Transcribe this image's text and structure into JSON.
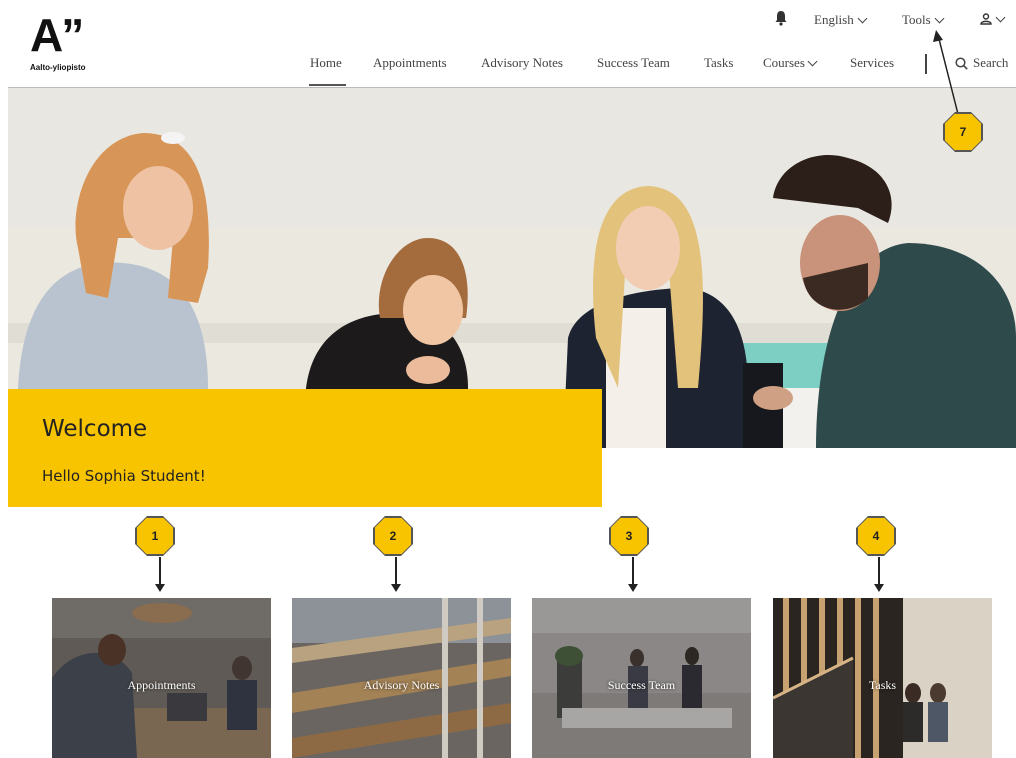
{
  "brand": {
    "mark": "A”",
    "name": "Aalto-yliopisto"
  },
  "utility": {
    "notifications_icon": "bell-icon",
    "language": "English",
    "tools": "Tools",
    "user_icon": "user-icon"
  },
  "nav": {
    "items": [
      {
        "label": "Home",
        "active": true
      },
      {
        "label": "Appointments"
      },
      {
        "label": "Advisory Notes"
      },
      {
        "label": "Success Team"
      },
      {
        "label": "Tasks"
      },
      {
        "label": "Courses",
        "has_dropdown": true
      },
      {
        "label": "Services"
      }
    ],
    "search_label": "Search",
    "search_icon": "search-icon"
  },
  "hero": {
    "title": "Welcome",
    "greeting": "Hello Sophia Student!",
    "accent_color": "#f8c400"
  },
  "callouts": [
    "1",
    "2",
    "3",
    "4",
    "7"
  ],
  "tiles": [
    {
      "label": "Appointments"
    },
    {
      "label": "Advisory Notes"
    },
    {
      "label": "Success Team"
    },
    {
      "label": "Tasks"
    }
  ]
}
